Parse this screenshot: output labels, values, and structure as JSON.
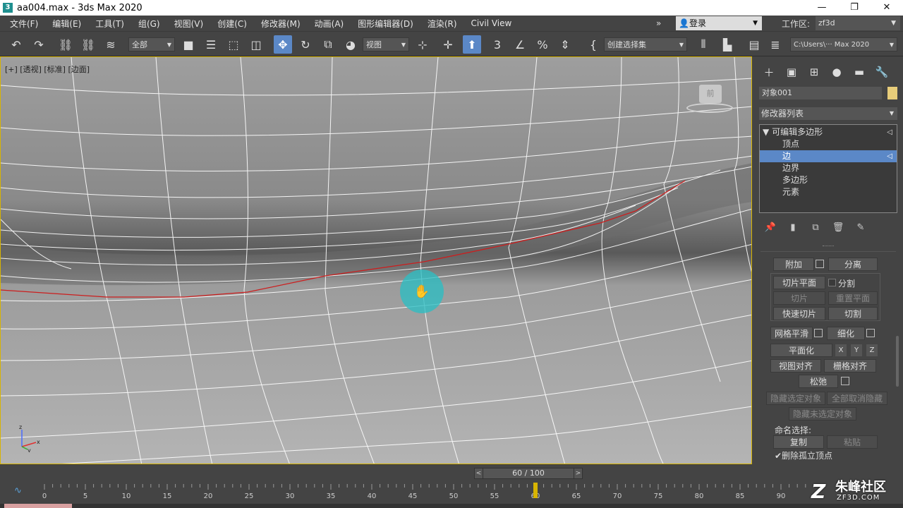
{
  "window": {
    "title": "aa004.max - 3ds Max 2020",
    "app_icon": "3",
    "minimize": "—",
    "maximize": "❐",
    "close": "✕"
  },
  "menu": {
    "items": [
      "文件(F)",
      "编辑(E)",
      "工具(T)",
      "组(G)",
      "视图(V)",
      "创建(C)",
      "修改器(M)",
      "动画(A)",
      "图形编辑器(D)",
      "渲染(R)",
      "Civil View"
    ],
    "more": "»",
    "login": "登录",
    "workspace_label": "工作区:",
    "workspace_value": "zf3d"
  },
  "toolbar": {
    "selection_filter": "全部",
    "reference_coord": "视图",
    "named_selection": "创建选择集",
    "path": "C:\\Users\\··· Max 2020"
  },
  "viewport": {
    "label": "[+] [透视] [标准] [边面]",
    "viewcube_face": "前",
    "axis_x": "x",
    "axis_y": "y",
    "axis_z": "z"
  },
  "panel": {
    "object_name": "对象001",
    "object_color": "#e8cd7a",
    "modifier_list": "修改器列表",
    "stack": {
      "root": "可编辑多边形",
      "items": [
        "顶点",
        "边",
        "边界",
        "多边形",
        "元素"
      ],
      "selected_index": 1
    },
    "buttons": {
      "attach": "附加",
      "detach": "分离",
      "slice_plane": "切片平面",
      "split": "分割",
      "slice": "切片",
      "reset_plane": "重置平面",
      "quickslice": "快速切片",
      "cut": "切割",
      "meshsmooth": "网格平滑",
      "tessellate": "细化",
      "make_planar": "平面化",
      "x": "X",
      "y": "Y",
      "z": "Z",
      "view_align": "视图对齐",
      "grid_align": "栅格对齐",
      "relax": "松弛",
      "hide_selected": "隐藏选定对象",
      "unhide_all": "全部取消隐藏",
      "hide_unselected": "隐藏未选定对象",
      "named_selections": "命名选择:",
      "copy": "复制",
      "paste": "粘贴",
      "delete_isolated": "✔删除孤立顶点"
    }
  },
  "timeline": {
    "frame_display": "60 / 100",
    "current_frame": 60,
    "total_frames": 100,
    "tick_labels": [
      "0",
      "5",
      "10",
      "15",
      "20",
      "25",
      "30",
      "35",
      "40",
      "45",
      "50",
      "55",
      "60",
      "65",
      "70",
      "75",
      "80",
      "85",
      "90"
    ]
  },
  "watermark": {
    "brand": "朱峰社区",
    "url": "ZF3D.COM",
    "logo": "Z"
  },
  "colors": {
    "selection_blue": "#5b88c7",
    "viewport_border": "#d8b400",
    "selected_edge": "#cc1e1e",
    "cursor_highlight": "#2dbec3"
  }
}
